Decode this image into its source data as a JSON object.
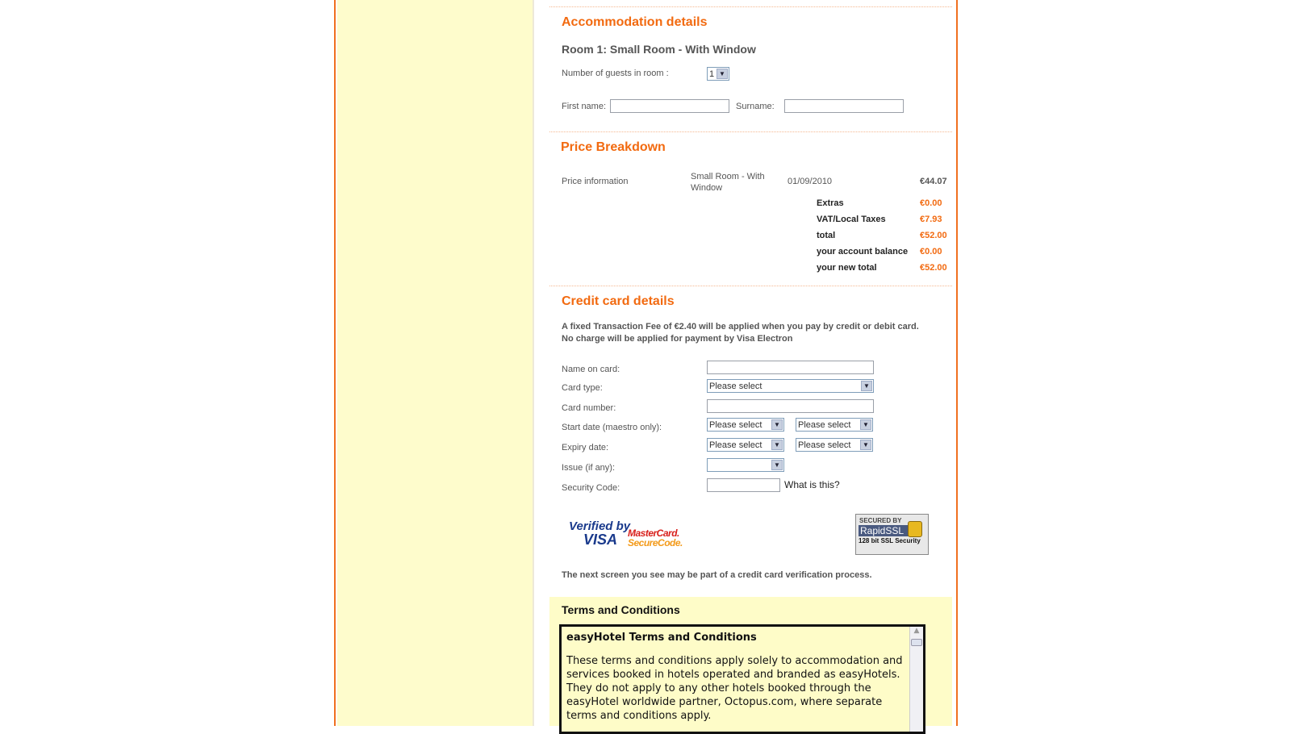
{
  "accommodation": {
    "heading": "Accommodation details",
    "room_title": "Room 1: Small Room - With Window",
    "guests_label": "Number of guests in room :",
    "guests_value": "1",
    "first_name_label": "First name:",
    "surname_label": "Surname:"
  },
  "price": {
    "heading": "Price Breakdown",
    "info_label": "Price information",
    "room": "Small Room - With Window",
    "date": "01/09/2010",
    "amount": "€44.07",
    "rows": [
      {
        "label": "Extras",
        "value": "€0.00"
      },
      {
        "label": "VAT/Local Taxes",
        "value": "€7.93"
      },
      {
        "label": "total",
        "value": "€52.00"
      },
      {
        "label": "your account balance",
        "value": "€0.00"
      },
      {
        "label": "your new total",
        "value": "€52.00"
      }
    ]
  },
  "card": {
    "heading": "Credit card details",
    "fee_line1": "A fixed Transaction Fee of  €2.40 will be applied when you pay by credit or debit card.",
    "fee_line2": "No charge will be applied for payment by Visa Electron",
    "name_label": "Name on card:",
    "type_label": "Card type:",
    "type_value": "Please select",
    "number_label": "Card number:",
    "start_label": "Start date (maestro only):",
    "expiry_label": "Expiry date:",
    "issue_label": "Issue (if any):",
    "security_label": "Security Code:",
    "select_placeholder": "Please select",
    "what_is_this": "What is this?",
    "visa_logo": {
      "line1": "Verified by",
      "line2": "VISA"
    },
    "mc_logo": {
      "line1": "MasterCard.",
      "line2": "SecureCode."
    },
    "ssl_logo": {
      "line1": "SECURED BY",
      "line2": "RapidSSL",
      "line3": "128 bit SSL Security"
    },
    "verification_note": "The next screen you see may be part of a credit card verification process."
  },
  "terms": {
    "heading": "Terms and Conditions",
    "box_title": "easyHotel Terms and Conditions",
    "box_text": "These terms and conditions apply solely to accommodation and services booked in hotels operated and branded as easyHotels. They do not apply to any other hotels booked through the easyHotel worldwide partner, Octopus.com, where separate terms and conditions apply."
  },
  "colors": {
    "accent": "#f26a10",
    "sidebar": "#fefccc"
  }
}
